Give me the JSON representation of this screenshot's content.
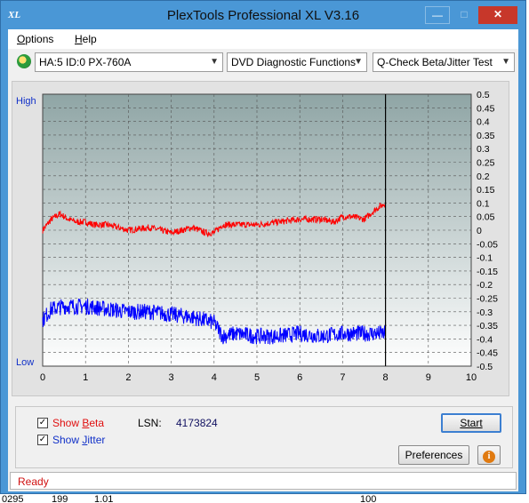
{
  "window": {
    "title": "PlexTools Professional XL V3.16",
    "icon_label": "XL"
  },
  "menu": [
    {
      "label": "Options",
      "accel_index": 0
    },
    {
      "label": "Help",
      "accel_index": 0
    }
  ],
  "toolbar": {
    "drive": "HA:5 ID:0  PX-760A",
    "function": "DVD Diagnostic Functions",
    "test": "Q-Check Beta/Jitter Test"
  },
  "chart_data": {
    "type": "line",
    "x_ticks": [
      "0",
      "1",
      "2",
      "3",
      "4",
      "5",
      "6",
      "7",
      "8",
      "9",
      "10"
    ],
    "xlim": [
      0,
      10
    ],
    "y_left_labels": {
      "top": "High",
      "bottom": "Low"
    },
    "y_right_ticks": [
      "0.5",
      "0.45",
      "0.4",
      "0.35",
      "0.3",
      "0.25",
      "0.2",
      "0.15",
      "0.1",
      "0.05",
      "0",
      "-0.05",
      "-0.1",
      "-0.15",
      "-0.2",
      "-0.25",
      "-0.3",
      "-0.35",
      "-0.4",
      "-0.45",
      "-0.5"
    ],
    "ylim": [
      -0.5,
      0.5
    ],
    "cursor_x": 8,
    "grid": true,
    "series": [
      {
        "key": "beta",
        "color": "#ff0000",
        "x": [
          0,
          0.2,
          0.4,
          0.6,
          0.8,
          1.0,
          1.2,
          1.5,
          2.0,
          2.5,
          3.0,
          3.5,
          3.8,
          4.0,
          4.2,
          4.5,
          5.0,
          5.5,
          6.0,
          6.5,
          6.8,
          7.0,
          7.2,
          7.5,
          7.8,
          8.0
        ],
        "y": [
          0.0,
          0.04,
          0.06,
          0.04,
          0.03,
          0.03,
          0.02,
          0.02,
          0.0,
          0.01,
          -0.01,
          0.01,
          -0.01,
          -0.01,
          0.02,
          0.02,
          0.02,
          0.03,
          0.04,
          0.04,
          0.03,
          0.05,
          0.05,
          0.04,
          0.08,
          0.1
        ],
        "noise": 0.012
      },
      {
        "key": "jitter",
        "color": "#0000ff",
        "x": [
          0,
          0.2,
          0.5,
          1.0,
          1.5,
          2.0,
          2.5,
          3.0,
          3.5,
          4.0,
          4.2,
          4.5,
          5.0,
          5.5,
          6.0,
          6.5,
          7.0,
          7.5,
          8.0
        ],
        "y": [
          -0.33,
          -0.29,
          -0.28,
          -0.28,
          -0.29,
          -0.3,
          -0.3,
          -0.31,
          -0.32,
          -0.34,
          -0.39,
          -0.38,
          -0.39,
          -0.39,
          -0.38,
          -0.39,
          -0.38,
          -0.38,
          -0.38
        ],
        "noise": 0.03
      }
    ]
  },
  "controls": {
    "show_beta": {
      "label": "Show Beta",
      "accel": "B",
      "checked": true
    },
    "show_jitter": {
      "label": "Show Jitter",
      "accel": "J",
      "checked": true
    },
    "lsn_label": "LSN:",
    "lsn_value": "4173824",
    "start_label": "Start",
    "preferences_label": "Preferences",
    "info_icon": "info-icon"
  },
  "status": {
    "text": "Ready"
  },
  "background_row": [
    "0295",
    "199",
    "1.01",
    "100"
  ]
}
